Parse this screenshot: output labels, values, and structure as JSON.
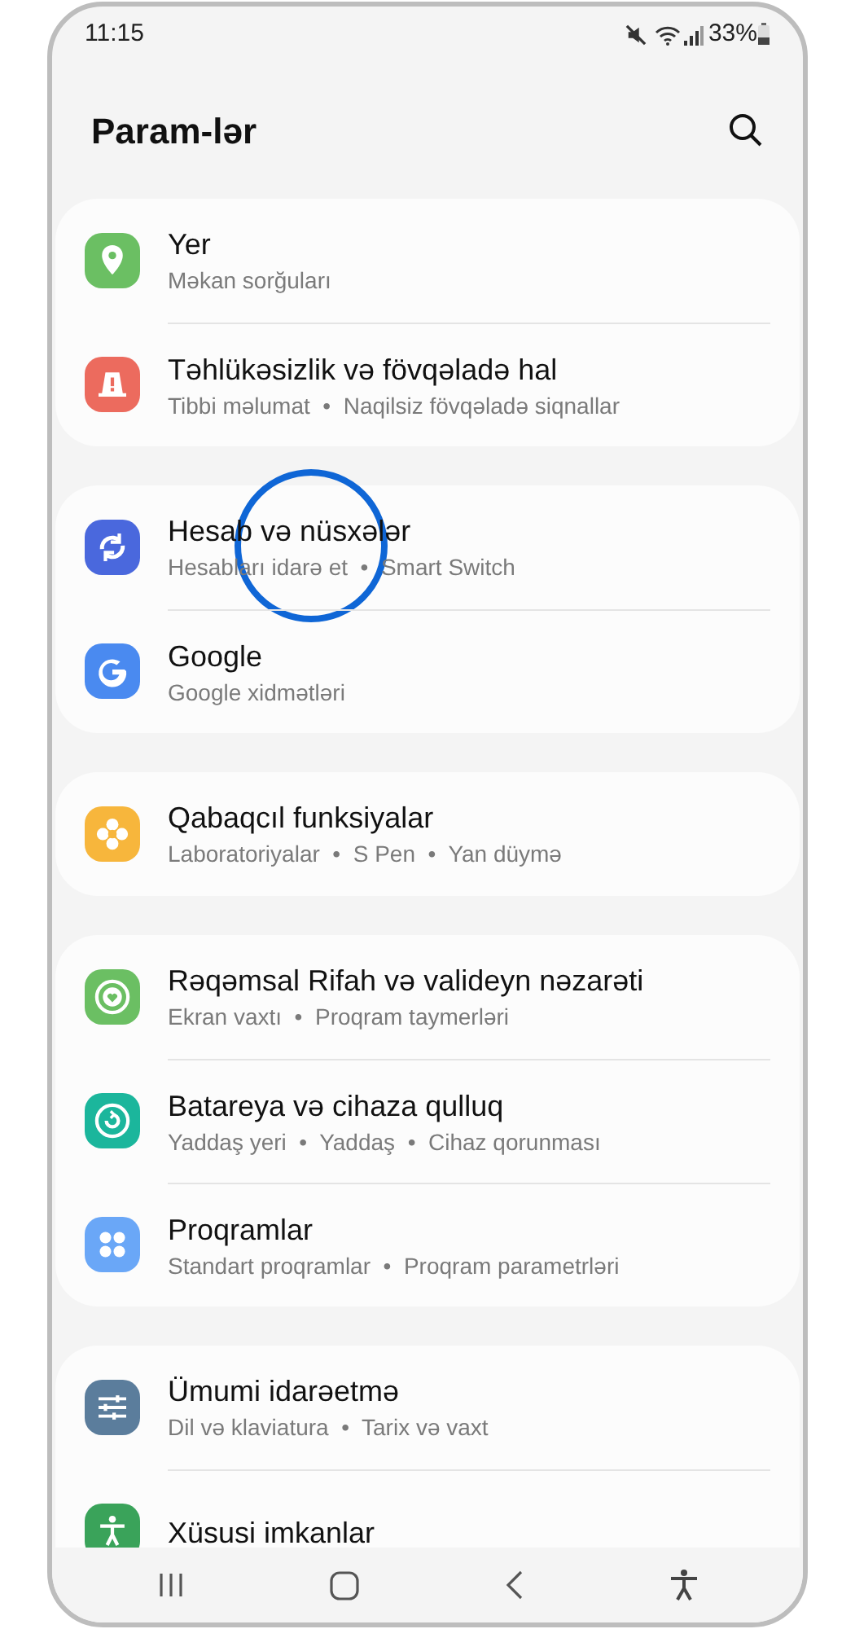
{
  "status_bar": {
    "time": "11:15",
    "battery": "33%"
  },
  "header": {
    "title": "Param-lər"
  },
  "groups": [
    {
      "items": [
        {
          "title": "Yer",
          "subtitle": "Məkan sorğuları",
          "kind": "pin",
          "color": "#6bbf63",
          "highlighted": false
        },
        {
          "title": "Təhlükəsizlik və fövqəladə hal",
          "subtitle": "Tibbi məlumat  •  Naqilsiz fövqəladə siqnallar",
          "kind": "alert",
          "color": "#ec6b5e",
          "highlighted": false
        }
      ]
    },
    {
      "items": [
        {
          "title": "Hesab və nüsxələr",
          "subtitle": "Hesabları idarə et  •  Smart Switch",
          "kind": "sync",
          "color": "#4a68dd",
          "highlighted": true
        },
        {
          "title": "Google",
          "subtitle": "Google xidmətləri",
          "kind": "google",
          "color": "#4a8af0",
          "highlighted": false
        }
      ]
    },
    {
      "items": [
        {
          "title": "Qabaqcıl funksiyalar",
          "subtitle": "Laboratoriyalar  •  S Pen  •  Yan düymə",
          "kind": "flower",
          "color": "#f7b63c",
          "highlighted": false
        }
      ]
    },
    {
      "items": [
        {
          "title": "Rəqəmsal Rifah və valideyn nəzarəti",
          "subtitle": "Ekran vaxtı  •  Proqram taymerləri",
          "kind": "heart",
          "color": "#6bbf63",
          "highlighted": false
        },
        {
          "title": "Batareya və cihaza qulluq",
          "subtitle": "Yaddaş yeri  •  Yaddaş  •  Cihaz qorunması",
          "kind": "care",
          "color": "#1bb69c",
          "highlighted": false
        },
        {
          "title": "Proqramlar",
          "subtitle": "Standart proqramlar  •  Proqram parametrləri",
          "kind": "apps",
          "color": "#6aa7f7",
          "highlighted": false
        }
      ]
    },
    {
      "items": [
        {
          "title": "Ümumi idarəetmə",
          "subtitle": "Dil və klaviatura  •  Tarix və vaxt",
          "kind": "sliders",
          "color": "#5b7d9c",
          "highlighted": false
        },
        {
          "title": "Xüsusi imkanlar",
          "kind": "person",
          "color": "#3aa35a",
          "highlighted": false
        }
      ]
    }
  ]
}
